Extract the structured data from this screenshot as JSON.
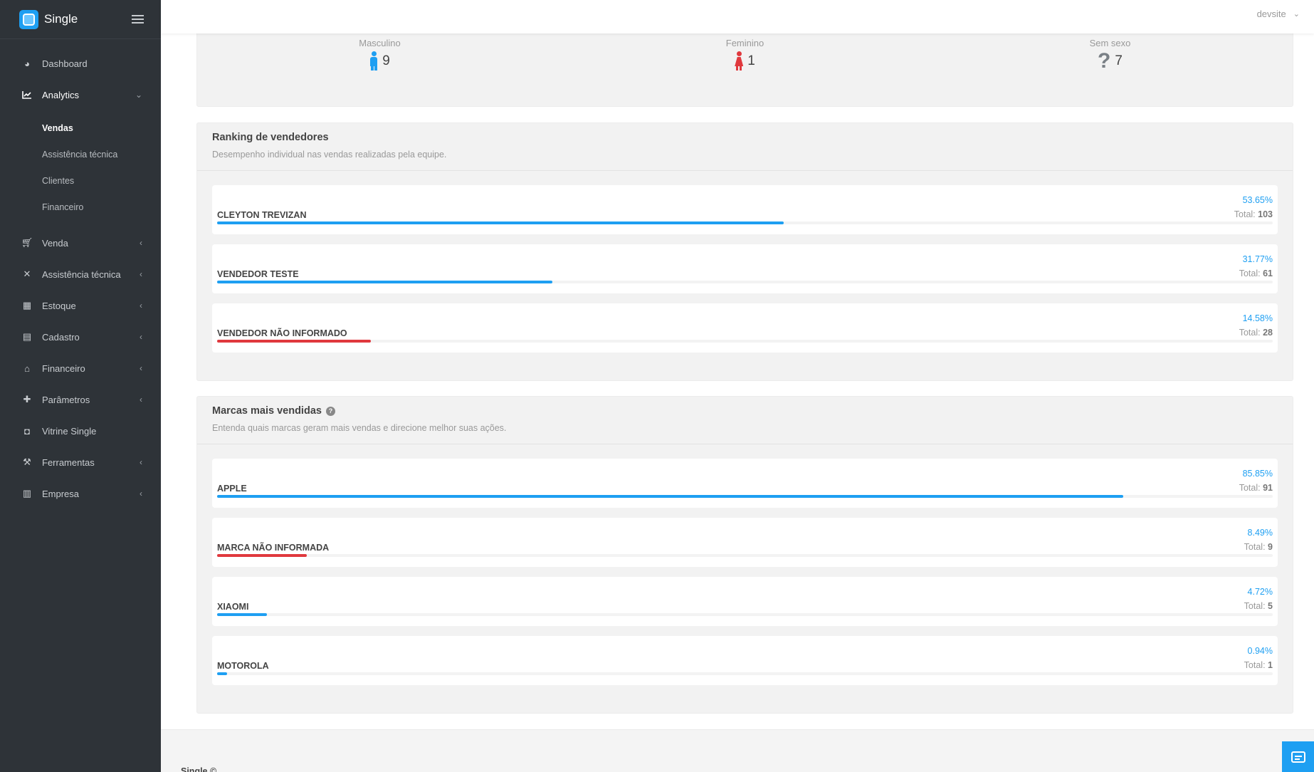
{
  "app": {
    "name": "Single"
  },
  "user": {
    "name": "devsite"
  },
  "colors": {
    "accent": "#1e9ff2",
    "danger": "#e0393e",
    "sidebar": "#2e3338"
  },
  "sidebar": {
    "items": [
      {
        "label": "Dashboard",
        "icon": "pie-chart-icon"
      },
      {
        "label": "Analytics",
        "icon": "line-chart-icon",
        "expanded": true,
        "children": [
          {
            "label": "Vendas",
            "current": true
          },
          {
            "label": "Assistência técnica"
          },
          {
            "label": "Clientes"
          },
          {
            "label": "Financeiro"
          }
        ]
      },
      {
        "label": "Venda",
        "icon": "cart-icon"
      },
      {
        "label": "Assistência técnica",
        "icon": "tools-icon"
      },
      {
        "label": "Estoque",
        "icon": "boxes-icon"
      },
      {
        "label": "Cadastro",
        "icon": "id-card-icon"
      },
      {
        "label": "Financeiro",
        "icon": "bank-icon"
      },
      {
        "label": "Parâmetros",
        "icon": "puzzle-icon"
      },
      {
        "label": "Vitrine Single",
        "icon": "shopping-bag-icon"
      },
      {
        "label": "Ferramentas",
        "icon": "wrench-icon"
      },
      {
        "label": "Empresa",
        "icon": "building-icon"
      }
    ]
  },
  "gender": [
    {
      "label": "Masculino",
      "value": "9",
      "icon": "male-icon",
      "color": "#1e9ff2"
    },
    {
      "label": "Feminino",
      "value": "1",
      "icon": "female-icon",
      "color": "#e0393e"
    },
    {
      "label": "Sem sexo",
      "value": "7",
      "icon": "question-icon",
      "color": "#7a8086"
    }
  ],
  "sellers": {
    "title": "Ranking de vendedores",
    "subtitle": "Desempenho individual nas vendas realizadas pela equipe.",
    "total_label": "Total:",
    "rows": [
      {
        "name": "CLEYTON TREVIZAN",
        "percent": "53.65%",
        "total": "103",
        "fraction": 0.5365,
        "color": "#1e9ff2"
      },
      {
        "name": "VENDEDOR TESTE",
        "percent": "31.77%",
        "total": "61",
        "fraction": 0.3177,
        "color": "#1e9ff2"
      },
      {
        "name": "VENDEDOR NÃO INFORMADO",
        "percent": "14.58%",
        "total": "28",
        "fraction": 0.1458,
        "color": "#e0393e"
      }
    ]
  },
  "brands": {
    "title": "Marcas mais vendidas",
    "subtitle": "Entenda quais marcas geram mais vendas e direcione melhor suas ações.",
    "total_label": "Total:",
    "rows": [
      {
        "name": "APPLE",
        "percent": "85.85%",
        "total": "91",
        "fraction": 0.8585,
        "color": "#1e9ff2"
      },
      {
        "name": "MARCA NÃO INFORMADA",
        "percent": "8.49%",
        "total": "9",
        "fraction": 0.0849,
        "color": "#e0393e"
      },
      {
        "name": "XIAOMI",
        "percent": "4.72%",
        "total": "5",
        "fraction": 0.0472,
        "color": "#1e9ff2"
      },
      {
        "name": "MOTOROLA",
        "percent": "0.94%",
        "total": "1",
        "fraction": 0.0094,
        "color": "#1e9ff2"
      }
    ]
  },
  "footer": {
    "text": "Single ©"
  }
}
